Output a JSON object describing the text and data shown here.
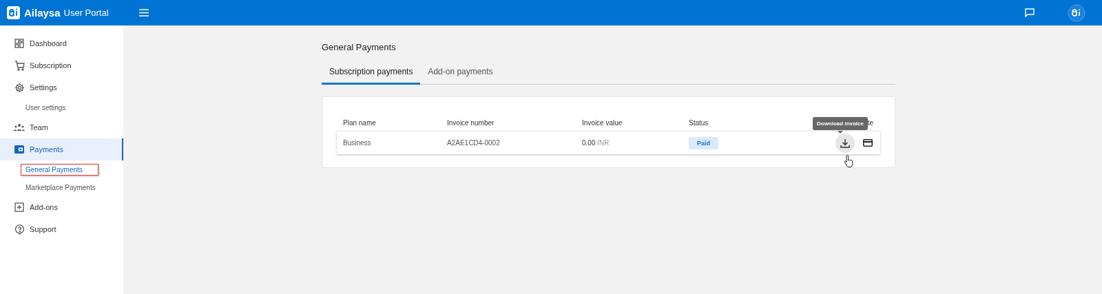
{
  "header": {
    "brand": "Ailaysa",
    "subtitle": "User Portal"
  },
  "sidebar": {
    "items": [
      {
        "label": "Dashboard",
        "kind": "dashboard",
        "selected": false
      },
      {
        "label": "Subscription",
        "kind": "cart",
        "selected": false
      },
      {
        "label": "Settings",
        "kind": "gear",
        "selected": false,
        "children": [
          {
            "label": "User settings",
            "selected": false,
            "highlighted": false
          }
        ]
      },
      {
        "label": "Team",
        "kind": "team",
        "selected": false
      },
      {
        "label": "Payments",
        "kind": "wallet",
        "selected": true,
        "children": [
          {
            "label": "General Payments",
            "selected": true,
            "highlighted": true
          },
          {
            "label": "Marketplace Payments",
            "selected": false,
            "highlighted": false
          }
        ]
      },
      {
        "label": "Add-ons",
        "kind": "plus",
        "selected": false
      },
      {
        "label": "Support",
        "kind": "help",
        "selected": false
      }
    ]
  },
  "page": {
    "title": "General Payments",
    "tabs": [
      {
        "label": "Subscription payments",
        "selected": true
      },
      {
        "label": "Add-on payments",
        "selected": false
      }
    ],
    "table": {
      "columns": [
        "Plan name",
        "Invoice number",
        "Invoice value",
        "Status",
        "te"
      ],
      "rows": [
        {
          "plan": "Business",
          "invoice_number": "A2AE1CD4-0002",
          "amount": "0.00",
          "currency": "INR",
          "status": "Paid"
        }
      ]
    },
    "tooltip": "Download invoice"
  }
}
